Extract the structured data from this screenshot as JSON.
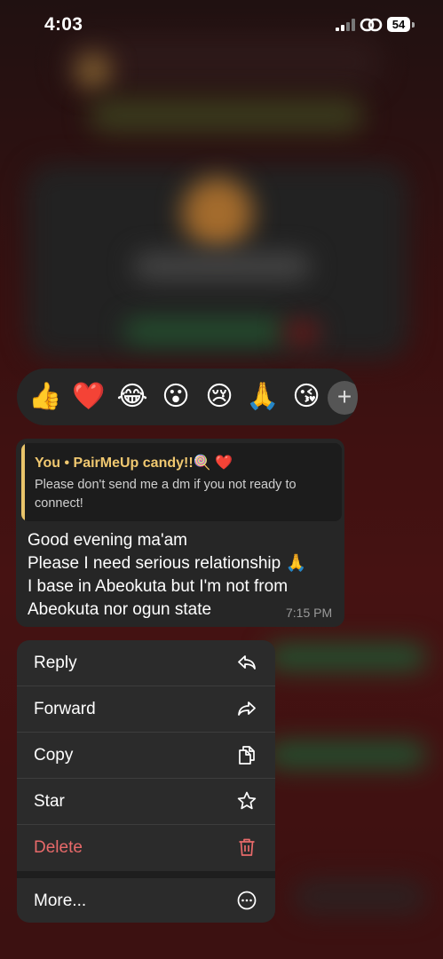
{
  "status_bar": {
    "time": "4:03",
    "battery": "54"
  },
  "reactions": {
    "emojis": [
      "👍",
      "❤️",
      "😂",
      "😮",
      "😢",
      "🙏",
      "😘"
    ],
    "add_label": "+"
  },
  "message": {
    "quote_title": "You • PairMeUp candy!!🍭 ❤️",
    "quote_text": "Please don't send me a dm if you not ready to connect!",
    "lines": [
      "Good evening ma'am",
      "Please I need serious relationship 🙏",
      "I base in Abeokuta but I'm not from",
      "Abeokuta nor ogun state"
    ],
    "time": "7:15 PM"
  },
  "menu": {
    "reply": "Reply",
    "forward": "Forward",
    "copy": "Copy",
    "star": "Star",
    "delete": "Delete",
    "more": "More..."
  },
  "colors": {
    "quote_accent": "#e8c46a",
    "quote_title": "#f0c870",
    "delete": "#e86a6a"
  }
}
